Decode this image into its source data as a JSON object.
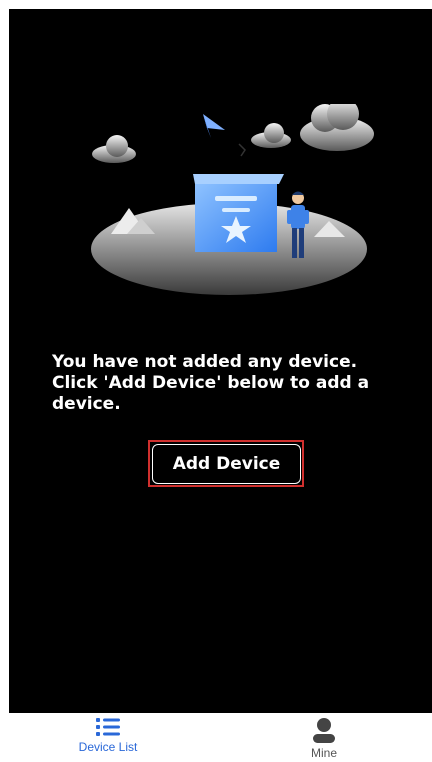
{
  "empty_state": {
    "message": "You have not added any device. Click 'Add Device' below to add a device.",
    "add_button_label": "Add Device"
  },
  "tabbar": {
    "tabs": [
      {
        "label": "Device List",
        "icon": "list-icon",
        "active": true
      },
      {
        "label": "Mine",
        "icon": "person-icon",
        "active": false
      }
    ]
  },
  "colors": {
    "accent": "#2a68d8",
    "highlight_border": "#d0302e",
    "background": "#000000"
  }
}
